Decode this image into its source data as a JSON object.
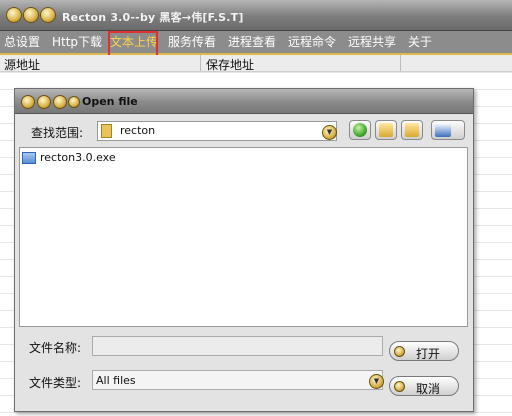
{
  "window": {
    "title": "Recton 3.0--by 黑客→伟[F.S.T]"
  },
  "menu": {
    "items": [
      "总设置",
      "Http下载",
      "文本上传",
      "服务传看",
      "进程查看",
      "远程命令",
      "远程共享",
      "关于"
    ]
  },
  "table": {
    "columns": [
      "源地址",
      "保存地址"
    ]
  },
  "dialog": {
    "title": "Open file",
    "look_in_label": "查找范围:",
    "look_in_value": "recton",
    "files": [
      "recton3.0.exe"
    ],
    "filename_label": "文件名称:",
    "filename_value": "",
    "filetype_label": "文件类型:",
    "filetype_value": "All files",
    "open_label": "打开",
    "cancel_label": "取消"
  },
  "icons": {
    "back": "back-arrow-icon",
    "up": "up-folder-icon",
    "new_folder": "new-folder-icon",
    "view": "view-menu-icon"
  },
  "colors": {
    "highlight": "#e03030",
    "menu_active": "#ffd34a"
  }
}
